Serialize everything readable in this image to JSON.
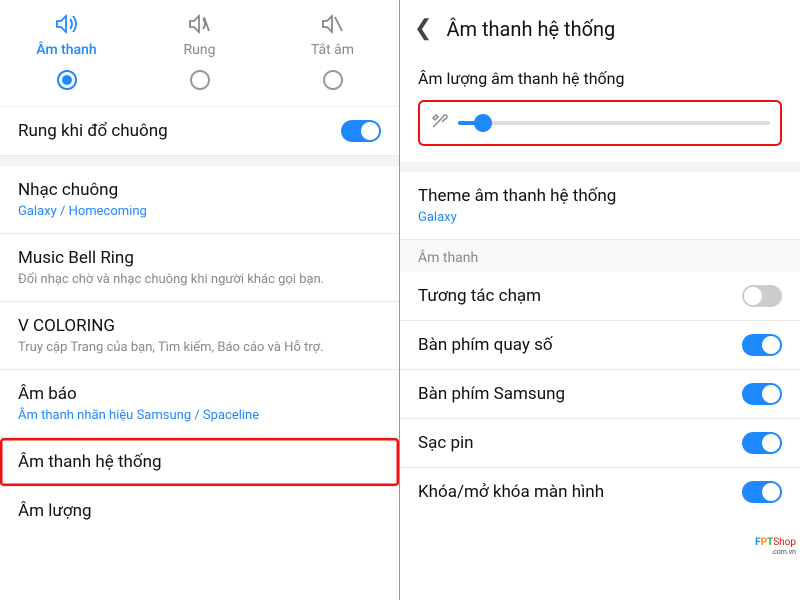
{
  "left": {
    "tabs": {
      "sound": "Âm thanh",
      "vibrate": "Rung",
      "mute": "Tắt âm"
    },
    "vibrate_on_ring": "Rung khi đổ chuông",
    "ringtone_title": "Nhạc chuông",
    "ringtone_value": "Galaxy / Homecoming",
    "musicbell_title": "Music Bell Ring",
    "musicbell_sub": "Đổi nhạc chờ và nhạc chuông khi người khác gọi bạn.",
    "vcoloring_title": "V COLORING",
    "vcoloring_sub": "Truy cập Trang của bạn, Tìm kiếm, Báo cáo và Hỗ trợ.",
    "notif_title": "Âm báo",
    "notif_sub": "Âm thanh nhãn hiệu Samsung / Spaceline",
    "system_sound_title": "Âm thanh hệ thống",
    "volume_title": "Âm lượng"
  },
  "right": {
    "header": "Âm thanh hệ thống",
    "volume_label": "Âm lượng âm thanh hệ thống",
    "theme_title": "Theme âm thanh hệ thống",
    "theme_value": "Galaxy",
    "section": "Âm thanh",
    "touch": "Tương tác chạm",
    "dialpad": "Bàn phím quay số",
    "samsung_kbd": "Bàn phím Samsung",
    "charging": "Sạc pin",
    "lock": "Khóa/mở khóa màn hình"
  },
  "watermark": {
    "brand": "FPTShop",
    "domain": ".com.vn"
  }
}
